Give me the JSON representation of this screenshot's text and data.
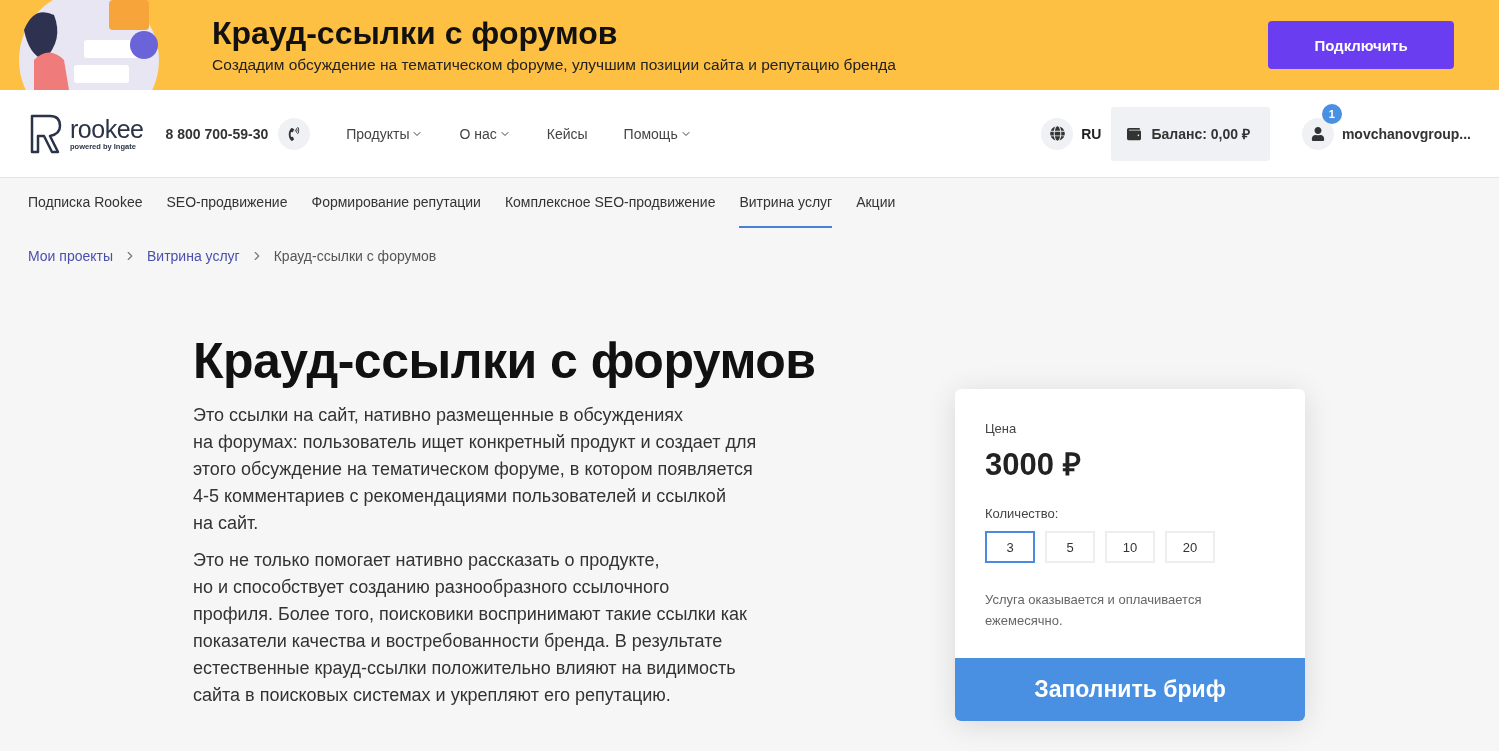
{
  "promo_banner": {
    "title": "Крауд-ссылки с форумов",
    "subtitle": "Создадим обсуждение на тематическом форуме, улучшим позиции сайта и репутацию бренда",
    "button": "Подключить"
  },
  "header": {
    "logo_text": "rookee",
    "logo_tagline": "powered by Ingate",
    "phone": "8 800 700-59-30",
    "menu": [
      {
        "label": "Продукты",
        "dropdown": true
      },
      {
        "label": "О нас",
        "dropdown": true
      },
      {
        "label": "Кейсы",
        "dropdown": false
      },
      {
        "label": "Помощь",
        "dropdown": true
      }
    ],
    "language": "RU",
    "balance": "Баланс: 0,00 ₽",
    "notifications": "1",
    "username": "movchanovgroup..."
  },
  "subnav": [
    {
      "label": "Подписка Rookee",
      "selected": false
    },
    {
      "label": "SEO-продвижение",
      "selected": false
    },
    {
      "label": "Формирование репутации",
      "selected": false
    },
    {
      "label": "Комплексное SEO-продвижение",
      "selected": false
    },
    {
      "label": "Витрина услуг",
      "selected": true
    },
    {
      "label": "Акции",
      "selected": false
    }
  ],
  "breadcrumbs": [
    "Мои проекты",
    "Витрина услуг",
    "Крауд-ссылки с форумов"
  ],
  "page_title": "Крауд-ссылки с форумов",
  "description": [
    [
      "Это ссылки на сайт, нативно размещенные в обсуждениях",
      "на форумах: пользователь ищет конкретный продукт и создает для",
      "этого обсуждение на тематическом форуме, в котором появляется",
      "4-5 комментариев с рекомендациями пользователей и ссылкой",
      "на сайт."
    ],
    [
      "Это не только помогает нативно рассказать о продукте,",
      "но и способствует созданию разнообразного ссылочного",
      "профиля. Более того, поисковики воспринимают такие ссылки как",
      "показатели качества и востребованности бренда. В результате",
      "естественные крауд-ссылки положительно влияют на видимость",
      "сайта в поисковых системах и укрепляют его репутацию."
    ]
  ],
  "order_card": {
    "price_label": "Цена",
    "price": "3000 ₽",
    "quantity_label": "Количество:",
    "quantity_options": [
      {
        "label": "3",
        "selected": true
      },
      {
        "label": "5",
        "selected": false
      },
      {
        "label": "10",
        "selected": false
      },
      {
        "label": "20",
        "selected": false
      }
    ],
    "note": "Услуга оказывается и оплачивается ежемесячно.",
    "button": "Заполнить бриф"
  }
}
